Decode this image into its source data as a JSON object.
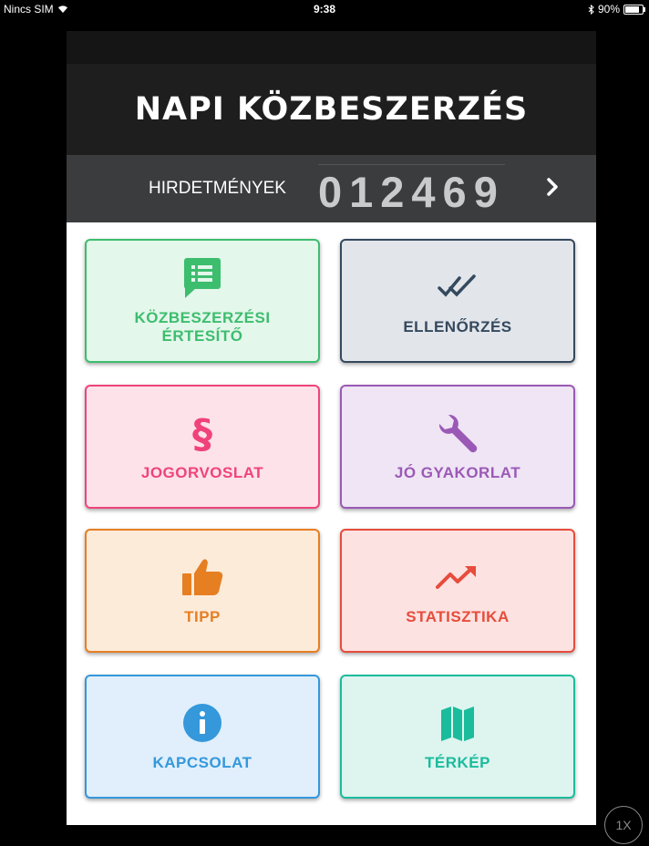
{
  "status_bar": {
    "carrier": "Nincs SIM",
    "time": "9:38",
    "battery": "90%",
    "battery_level": 0.9
  },
  "header": {
    "title": "NAPI KÖZBESZERZÉS"
  },
  "counter": {
    "label": "HIRDETMÉNYEK",
    "value": "012469"
  },
  "tiles": [
    {
      "label": "KÖZBESZERZÉSI\nÉRTESÍTŐ",
      "icon": "notice-chat-icon",
      "color": "#3dbd6e",
      "bg": "#e3f7eb"
    },
    {
      "label": "ELLENŐRZÉS",
      "icon": "double-check-icon",
      "color": "#34495e",
      "bg": "#e2e5ea"
    },
    {
      "label": "JOGORVOSLAT",
      "icon": "paragraph-icon",
      "color": "#f0437b",
      "bg": "#fde2ea"
    },
    {
      "label": "JÓ GYAKORLAT",
      "icon": "wrench-icon",
      "color": "#9b59b6",
      "bg": "#efe5f5"
    },
    {
      "label": "TIPP",
      "icon": "thumbs-up-icon",
      "color": "#e67e22",
      "bg": "#fcebd9"
    },
    {
      "label": "STATISZTIKA",
      "icon": "trend-up-icon",
      "color": "#e74c3c",
      "bg": "#fce2e0"
    },
    {
      "label": "KAPCSOLAT",
      "icon": "info-icon",
      "color": "#3498db",
      "bg": "#e0effb"
    },
    {
      "label": "TÉRKÉP",
      "icon": "map-icon",
      "color": "#1abc9c",
      "bg": "#ddf4ef"
    }
  ],
  "zoom_badge": "1X"
}
